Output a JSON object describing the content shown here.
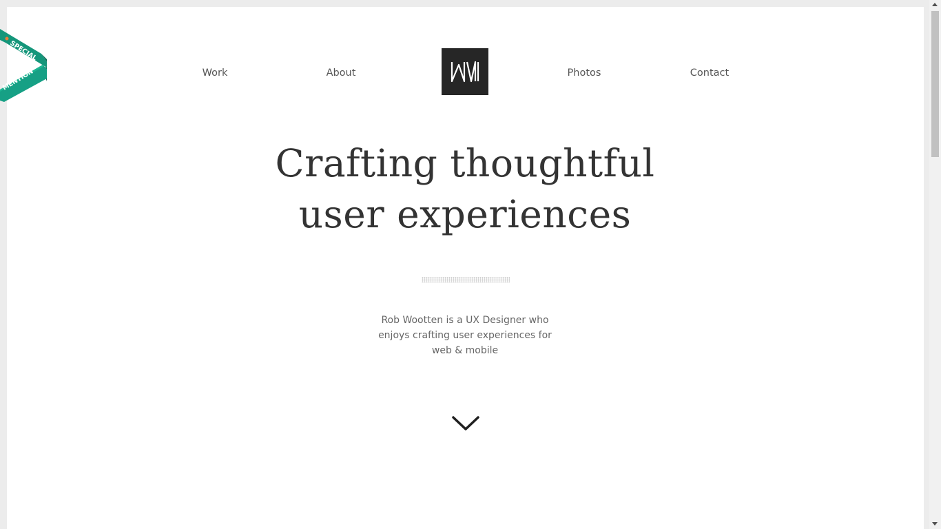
{
  "nav": {
    "links": [
      {
        "label": "Work"
      },
      {
        "label": "About"
      },
      {
        "label": "Photos"
      },
      {
        "label": "Contact"
      }
    ],
    "logo_icon": "rw-monogram-logo"
  },
  "hero": {
    "headline_line1": "Crafting thoughtful",
    "headline_line2": "user experiences",
    "intro": "Rob Wootten is a UX Designer who enjoys crafting user experiences for web & mobile",
    "scroll_icon": "chevron-down-icon"
  },
  "badge": {
    "line1": "SPECIAL",
    "line2": "MENTION",
    "color": "#14967a"
  },
  "colors": {
    "logo_bg": "#262626",
    "text": "#333333",
    "muted": "#666666"
  }
}
